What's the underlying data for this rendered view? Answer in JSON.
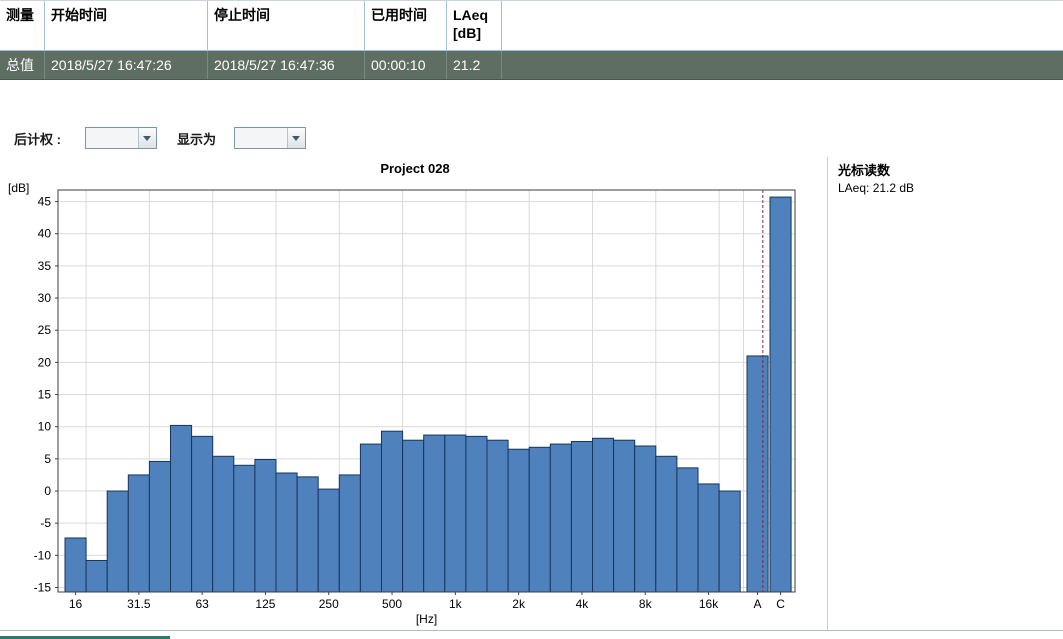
{
  "table": {
    "columns": [
      "测量",
      "开始时间",
      "停止时间",
      "已用时间",
      "LAeq\n[dB]"
    ],
    "row": [
      "总值",
      "2018/5/27 16:47:26",
      "2018/5/27 16:47:36",
      "00:00:10",
      "21.2"
    ]
  },
  "controls": {
    "post_weighting_label": "后计权 :",
    "post_weighting_value": "",
    "display_as_label": "显示为",
    "display_as_value": ""
  },
  "cursor_panel": {
    "title": "光标读数",
    "reading": "LAeq: 21.2 dB"
  },
  "chart_data": {
    "type": "bar",
    "title": "Project 028",
    "xlabel": "[Hz]",
    "ylabel": "[dB]",
    "ylim": [
      -15.7,
      46.8
    ],
    "yticks": [
      -15,
      -10,
      -5,
      0,
      5,
      10,
      15,
      20,
      25,
      30,
      35,
      40,
      45
    ],
    "x_tick_labels": [
      "16",
      "31.5",
      "63",
      "125",
      "250",
      "500",
      "1k",
      "2k",
      "4k",
      "8k",
      "16k"
    ],
    "bands": [
      "16",
      "20",
      "25",
      "31.5",
      "40",
      "50",
      "63",
      "80",
      "100",
      "125",
      "160",
      "200",
      "250",
      "315",
      "400",
      "500",
      "630",
      "800",
      "1k",
      "1.25k",
      "1.6k",
      "2k",
      "2.5k",
      "3.15k",
      "4k",
      "5k",
      "6.3k",
      "8k",
      "10k",
      "12.5k",
      "16k",
      "20k"
    ],
    "values": [
      -7.3,
      -10.8,
      0.0,
      2.5,
      4.6,
      10.2,
      8.5,
      5.4,
      4.0,
      4.9,
      2.8,
      2.2,
      0.3,
      2.5,
      7.3,
      9.3,
      7.9,
      8.7,
      8.7,
      8.5,
      7.9,
      6.5,
      6.8,
      7.3,
      7.7,
      8.2,
      7.9,
      7.0,
      5.4,
      3.6,
      1.1,
      0.0
    ],
    "extra_bars": [
      {
        "label": "A",
        "value": 21.0
      },
      {
        "label": "C",
        "value": 45.7
      }
    ],
    "cursor_at": "A",
    "grid": true,
    "legend": false,
    "bar_color": "#4f81bd",
    "bar_border": "#17365d",
    "grid_color": "#d9d9d9",
    "cursor_color": "#7a2b45"
  }
}
